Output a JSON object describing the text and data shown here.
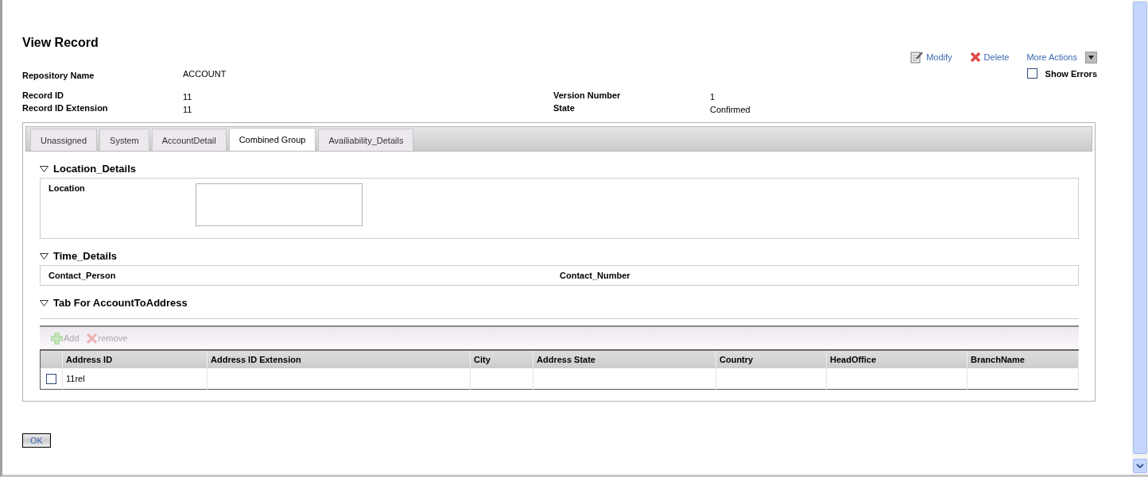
{
  "title": "View Record",
  "actions": {
    "modify": "Modify",
    "delete": "Delete",
    "more": "More Actions",
    "show_errors": {
      "label": "Show Errors",
      "checked": false
    }
  },
  "header_fields": [
    {
      "label": "Repository Name",
      "value": "ACCOUNT"
    },
    {
      "label": "Record ID",
      "value": "11"
    },
    {
      "label": "Record ID Extension",
      "value": "11"
    }
  ],
  "header_fields_right": [
    {
      "label": "Version Number",
      "value": "1"
    },
    {
      "label": "State",
      "value": "Confirmed"
    }
  ],
  "tabs": [
    {
      "label": "Unassigned",
      "selected": false
    },
    {
      "label": "System",
      "selected": false
    },
    {
      "label": "AccountDetail",
      "selected": false
    },
    {
      "label": "Combined Group",
      "selected": true
    },
    {
      "label": "Availiability_Details",
      "selected": false
    }
  ],
  "location_details": {
    "title": "Location_Details",
    "expanded": true,
    "fields": [
      {
        "label": "Location"
      }
    ]
  },
  "time_details": {
    "title": "Time_Details",
    "expanded": true,
    "fields": [
      {
        "label": "Contact_Person"
      },
      {
        "label": "Contact_Number"
      }
    ]
  },
  "relation": {
    "title": "Tab For AccountToAddress",
    "expanded": true,
    "toolbar": [
      {
        "label": "Add",
        "kind": "add",
        "disabled": true
      },
      {
        "label": "remove",
        "kind": "remove",
        "disabled": true
      }
    ],
    "columns": [
      "Address ID",
      "Address ID Extension",
      "City",
      "Address State",
      "Country",
      "HeadOffice",
      "BranchName"
    ],
    "rows": [
      {
        "selected": false,
        "cells": [
          "11rel",
          "",
          "",
          "",
          "",
          "",
          ""
        ]
      }
    ]
  },
  "ok_button": "OK"
}
